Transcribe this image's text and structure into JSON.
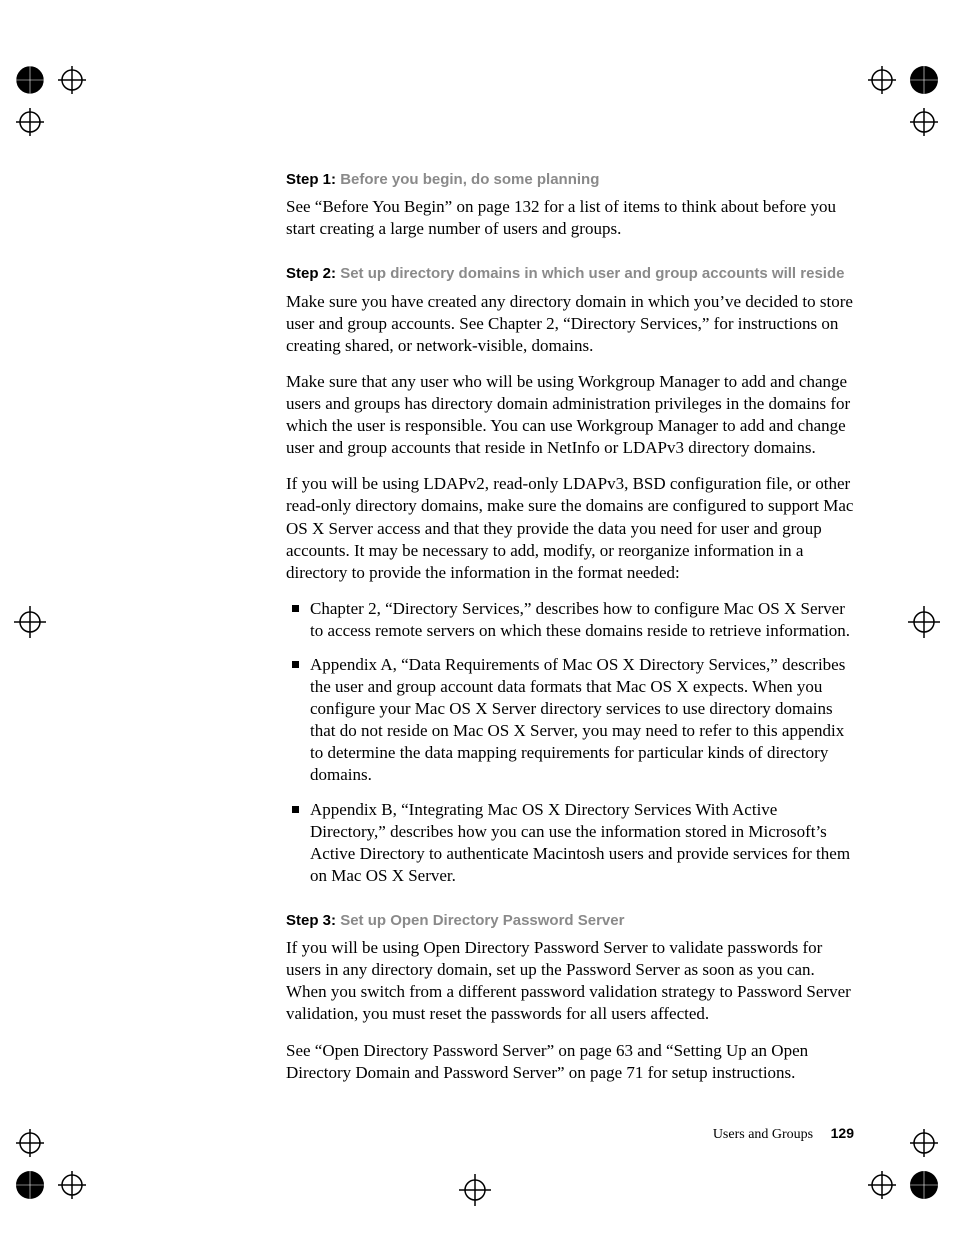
{
  "step1": {
    "label": "Step 1:",
    "title": "Before you begin, do some planning",
    "p1": "See “Before You Begin” on page 132 for a list of items to think about before you start creating a large number of users and groups."
  },
  "step2": {
    "label": "Step 2:",
    "title": "Set up directory domains in which user and group accounts will reside",
    "p1": "Make sure you have created any directory domain in which you’ve decided to store user and group accounts. See Chapter 2, “Directory Services,” for instructions on creating shared, or network-visible, domains.",
    "p2": "Make sure that any user who will be using Workgroup Manager to add and change users and groups has directory domain administration privileges in the domains for which the user is responsible. You can use Workgroup Manager to add and change user and group accounts that reside in NetInfo or LDAPv3 directory domains.",
    "p3": "If you will be using LDAPv2, read-only LDAPv3, BSD configuration file, or other read-only directory domains, make sure the domains are configured to support Mac OS X Server access and that they provide the data you need for user and group accounts. It may be necessary to add, modify, or reorganize information in a directory to provide the information in the format needed:",
    "bullets": [
      "Chapter 2, “Directory Services,” describes how to configure Mac OS X Server to access remote servers on which these domains reside to retrieve information.",
      "Appendix A, “Data Requirements of Mac OS X Directory Services,” describes the user and group account data formats that Mac OS X expects. When you configure your Mac OS X Server directory services to use directory domains that do not reside on Mac OS X Server, you may need to refer to this appendix to determine the data mapping requirements for particular kinds of directory domains.",
      "Appendix B, “Integrating Mac OS X Directory Services With Active Directory,” describes how you can use the information stored in Microsoft’s Active Directory to authenticate Macintosh users and provide services for them on Mac OS X Server."
    ]
  },
  "step3": {
    "label": "Step 3:",
    "title": "Set up Open Directory Password Server",
    "p1": "If you will be using Open Directory Password Server to validate passwords for users in any directory domain, set up the Password Server as soon as you can. When you switch from a different password validation strategy to Password Server validation, you must reset the passwords for all users affected.",
    "p2": "See “Open Directory Password Server” on page 63 and “Setting Up an Open Directory Domain and Password Server” on page 71 for setup instructions."
  },
  "footer": {
    "section": "Users and Groups",
    "page": "129"
  }
}
